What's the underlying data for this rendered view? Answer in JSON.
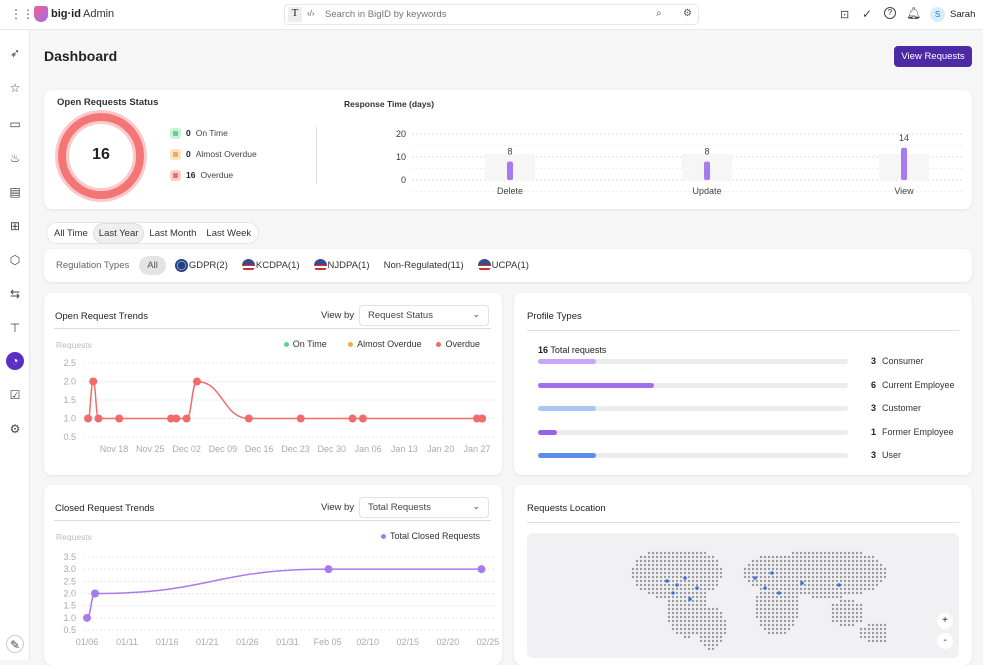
{
  "topbar": {
    "brand": "big·id",
    "app": "Admin",
    "search_placeholder": "Search in BigID by keywords",
    "user_initial": "S",
    "user_name": "Sarah"
  },
  "page": {
    "title": "Dashboard",
    "view_requests": "View Requests"
  },
  "status": {
    "title": "Open Requests Status",
    "total": "16",
    "items": [
      {
        "count": "0",
        "label": "On Time",
        "color": "#5ed48a"
      },
      {
        "count": "0",
        "label": "Almost Overdue",
        "color": "#f5a94e"
      },
      {
        "count": "16",
        "label": "Overdue",
        "color": "#f26b6b"
      }
    ]
  },
  "response": {
    "title": "Response Time (days)",
    "yticks": [
      "20",
      "10",
      "0"
    ],
    "ymax": 20,
    "categories": [
      "Delete",
      "Update",
      "View"
    ],
    "values": [
      8,
      8,
      14
    ],
    "labels": [
      "8",
      "8",
      "14"
    ],
    "color": "#a87af0"
  },
  "time_filters": {
    "items": [
      "All Time",
      "Last Year",
      "Last Month",
      "Last Week"
    ],
    "active": 1
  },
  "regulations": {
    "label": "Regulation Types",
    "items": [
      {
        "label": "All",
        "flag": ""
      },
      {
        "label": "GDPR(2)",
        "flag": "eu"
      },
      {
        "label": "KCDPA(1)",
        "flag": "us"
      },
      {
        "label": "NJDPA(1)",
        "flag": "us"
      },
      {
        "label": "Non-Regulated(11)",
        "flag": ""
      },
      {
        "label": "UCPA(1)",
        "flag": "us"
      }
    ]
  },
  "open_trends": {
    "title": "Open Request Trends",
    "view_by": "View by",
    "select": "Request Status",
    "ylabel": "Requests",
    "legend": [
      {
        "label": "On Time",
        "color": "#5ed48a"
      },
      {
        "label": "Almost Overdue",
        "color": "#f5a94e"
      },
      {
        "label": "Overdue",
        "color": "#f26b6b"
      }
    ],
    "chart_data": {
      "type": "line",
      "ylim": [
        0.5,
        2.5
      ],
      "yticks": [
        "2.5",
        "2.0",
        "1.5",
        "1.0",
        "0.5"
      ],
      "xticks": [
        "Nov 18",
        "Nov 25",
        "Dec 02",
        "Dec 09",
        "Dec 16",
        "Dec 23",
        "Dec 30",
        "Jan 06",
        "Jan 13",
        "Jan 20",
        "Jan 27"
      ],
      "series": [
        {
          "name": "Overdue",
          "color": "#f26b6b",
          "points": [
            [
              "2024-11-13",
              1
            ],
            [
              "2024-11-14",
              2
            ],
            [
              "2024-11-15",
              1
            ],
            [
              "2024-11-19",
              1
            ],
            [
              "2024-11-29",
              1
            ],
            [
              "2024-11-30",
              1
            ],
            [
              "2024-12-02",
              1
            ],
            [
              "2024-12-04",
              2
            ],
            [
              "2024-12-14",
              1
            ],
            [
              "2024-12-24",
              1
            ],
            [
              "2025-01-03",
              1
            ],
            [
              "2025-01-05",
              1
            ],
            [
              "2025-01-27",
              1
            ],
            [
              "2025-01-28",
              1
            ]
          ]
        }
      ]
    }
  },
  "profile_types": {
    "title": "Profile Types",
    "total": "16",
    "total_label": "Total requests",
    "items": [
      {
        "count": "3",
        "label": "Consumer",
        "value": 3,
        "color": "#c9a6f7"
      },
      {
        "count": "6",
        "label": "Current Employee",
        "value": 6,
        "color": "#a26ef0"
      },
      {
        "count": "3",
        "label": "Customer",
        "value": 3,
        "color": "#a9c6f5"
      },
      {
        "count": "1",
        "label": "Former Employee",
        "value": 1,
        "color": "#9a62ea"
      },
      {
        "count": "3",
        "label": "User",
        "value": 3,
        "color": "#5b8def"
      }
    ]
  },
  "closed_trends": {
    "title": "Closed Request Trends",
    "view_by": "View by",
    "select": "Total Requests",
    "ylabel": "Requests",
    "legend": [
      {
        "label": "Total Closed Requests",
        "color": "#a87af0"
      }
    ],
    "chart_data": {
      "type": "line",
      "ylim": [
        0.5,
        3.5
      ],
      "yticks": [
        "3.5",
        "3.0",
        "2.5",
        "2.0",
        "1.5",
        "1.0",
        "0.5"
      ],
      "xticks": [
        "01/06",
        "01/11",
        "01/16",
        "01/21",
        "01/26",
        "01/31",
        "Feb 05",
        "02/10",
        "02/15",
        "02/20",
        "02/25"
      ],
      "series": [
        {
          "name": "Total Closed Requests",
          "color": "#a87af0",
          "points": [
            [
              "2025-01-06",
              1
            ],
            [
              "2025-01-07",
              2
            ],
            [
              "2025-02-05",
              3
            ],
            [
              "2025-02-24",
              3
            ]
          ]
        }
      ]
    }
  },
  "location": {
    "title": "Requests Location",
    "zoom_in": "+",
    "zoom_out": "-"
  }
}
